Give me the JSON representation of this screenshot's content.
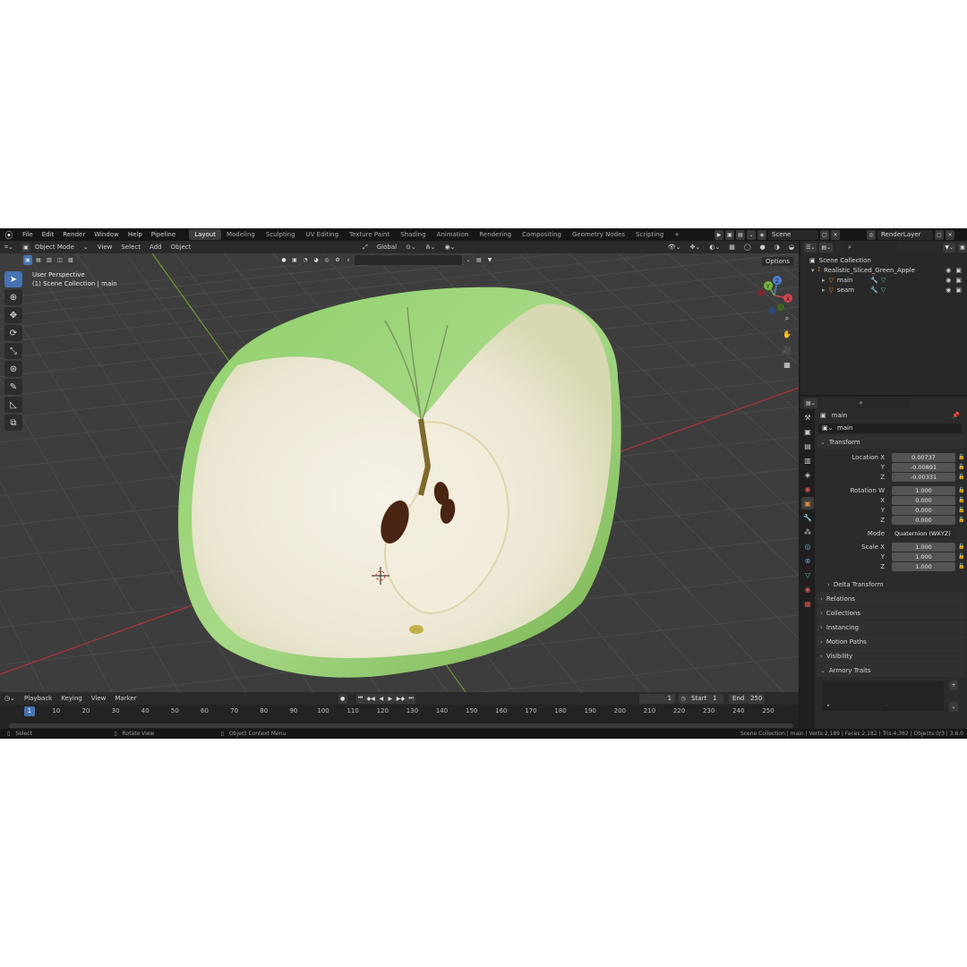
{
  "topbar": {
    "menus": [
      "File",
      "Edit",
      "Render",
      "Window",
      "Help",
      "Pipeline"
    ],
    "workspaces": [
      "Layout",
      "Modeling",
      "Sculpting",
      "UV Editing",
      "Texture Paint",
      "Shading",
      "Animation",
      "Rendering",
      "Compositing",
      "Geometry Nodes",
      "Scripting"
    ],
    "active_workspace": "Layout",
    "add_tab": "+",
    "scene": "Scene",
    "render_layer": "RenderLayer"
  },
  "viewport_header": {
    "mode": "Object Mode",
    "menus": [
      "View",
      "Select",
      "Add",
      "Object"
    ],
    "orientation": "Global",
    "options": "Options"
  },
  "viewport": {
    "perspective": "User Perspective",
    "collection": "(1) Scene Collection | main",
    "gizmo_axes": [
      "X",
      "Y",
      "Z"
    ],
    "grid_color": "#4a4a4a",
    "x_axis_color": "#b0343c",
    "y_axis_color": "#6c9a32"
  },
  "timeline": {
    "menus": [
      "Playback",
      "Keying",
      "View",
      "Marker"
    ],
    "current_frame": "1",
    "start_label": "Start",
    "start": "1",
    "end_label": "End",
    "end": "250",
    "ticks": [
      "1",
      "10",
      "20",
      "30",
      "40",
      "50",
      "60",
      "70",
      "80",
      "90",
      "100",
      "110",
      "120",
      "130",
      "140",
      "150",
      "160",
      "170",
      "180",
      "190",
      "200",
      "210",
      "220",
      "230",
      "240",
      "250"
    ]
  },
  "statusbar": {
    "select": "Select",
    "rotate": "Rotate View",
    "context": "Object Context Menu",
    "stats": "Scene Collection | main | Verts:2,189 | Faces:2,182 | Tris:4,362 | Objects:0/3 | 3.6.0"
  },
  "outliner": {
    "root": "Scene Collection",
    "items": [
      {
        "name": "Realistic_Sliced_Green_Apple",
        "depth": 1
      },
      {
        "name": "main",
        "depth": 2
      },
      {
        "name": "seam",
        "depth": 2
      }
    ]
  },
  "properties": {
    "object_name": "main",
    "object_field": "main",
    "transform_label": "Transform",
    "location_label": "Location X",
    "location": {
      "x": "0.00737",
      "y": "-0.00891",
      "z": "-0.00331"
    },
    "rotation_label": "Rotation W",
    "rotation": {
      "w": "1.000",
      "x": "0.000",
      "y": "0.000",
      "z": "0.000"
    },
    "mode_label": "Mode",
    "mode_value": "Quaternion (WXYZ)",
    "scale_label": "Scale X",
    "scale": {
      "x": "1.000",
      "y": "1.000",
      "z": "1.000"
    },
    "y_label": "Y",
    "z_label": "Z",
    "x_label": "X",
    "delta": "Delta Transform",
    "panels": [
      "Relations",
      "Collections",
      "Instancing",
      "Motion Paths",
      "Visibility",
      "Armory Traits"
    ]
  }
}
